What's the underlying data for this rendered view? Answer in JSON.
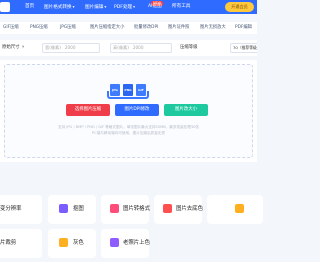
{
  "nav": {
    "items": [
      {
        "label": "首页",
        "caret": false
      },
      {
        "label": "图片格式转换",
        "caret": true
      },
      {
        "label": "图片编辑",
        "caret": true
      },
      {
        "label": "PDF处理",
        "caret": true
      },
      {
        "label": "AI抠图",
        "caret": false
      },
      {
        "label": "所有工具",
        "caret": false
      }
    ],
    "new_badge": "NEW",
    "vip_button": "开通会员"
  },
  "tool_tabs": [
    "GIF压缩",
    "PNG压缩",
    "JPG压缩",
    "图片压缩指定大小",
    "批量修改DPI",
    "图片证件照",
    "图片无损放大",
    "PDF编辑"
  ],
  "settings": {
    "size_mode_label": "原始尺寸",
    "width_label": "宽(像素)",
    "width_value": "2000",
    "height_label": "高(像素)",
    "height_value": "2000",
    "quality_label": "压缩等级",
    "quality_value": "70（推荐等级）"
  },
  "upload": {
    "file_icons": [
      "JPG",
      "PNG",
      "GIF"
    ],
    "buttons": {
      "select": "选择图片压缩",
      "dpi": "图片DPI修改",
      "resize": "图片改大小"
    },
    "hint_line1": "支持 JPG / BMP / PNG / GIF 等格式图片，单张图片最大支持50MB，最多批量处理30张",
    "hint_line2": "PC端与移动端均可使用，图片压缩后质量无损"
  },
  "features": [
    {
      "label": "变分辨率",
      "color": "#ff5a5a"
    },
    {
      "label": "抠图",
      "color": "#7b5cff"
    },
    {
      "label": "图片转格式",
      "color": "#ff4d7a"
    },
    {
      "label": "图片去底色",
      "color": "#ff4f4f"
    },
    {
      "label": "",
      "color": "#ffb020"
    },
    {
      "label": "片裁剪",
      "color": "#ff7a45"
    },
    {
      "label": "灰色",
      "color": "#ffb020"
    },
    {
      "label": "老照片上色",
      "color": "#8e5cff"
    }
  ]
}
